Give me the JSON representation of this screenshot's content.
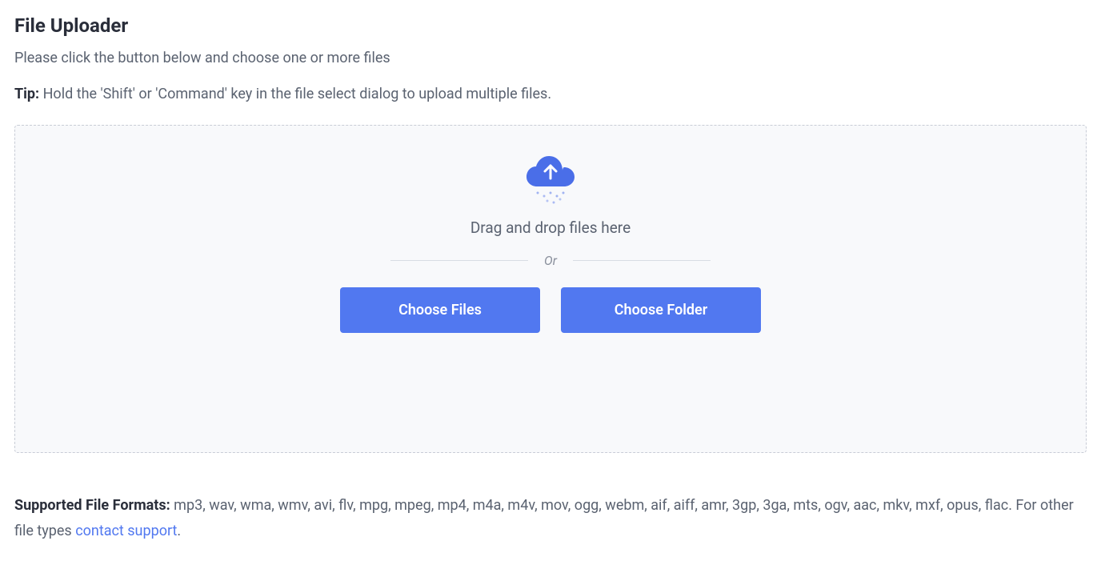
{
  "header": {
    "title": "File Uploader",
    "subtitle": "Please click the button below and choose one or more files",
    "tip_label": "Tip:",
    "tip_text": " Hold the 'Shift' or 'Command' key in the file select dialog to upload multiple files."
  },
  "dropzone": {
    "drag_text": "Drag and drop files here",
    "or_text": "Or",
    "choose_files_label": "Choose Files",
    "choose_folder_label": "Choose Folder"
  },
  "footer": {
    "formats_label": "Supported File Formats:",
    "formats_text": " mp3, wav, wma, wmv, avi, flv, mpg, mpeg, mp4, m4a, m4v, mov, ogg, webm, aif, aiff, amr, 3gp, 3ga, mts, ogv, aac, mkv, mxf, opus, flac. For other file types ",
    "contact_text": "contact support",
    "period": "."
  }
}
